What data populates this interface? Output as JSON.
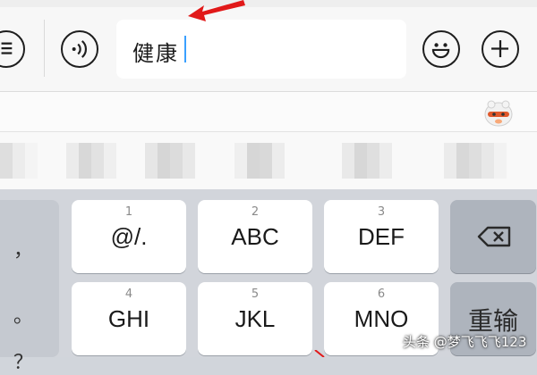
{
  "input_bar": {
    "text_value": "健康",
    "arrow_color": "#e11919",
    "icons": [
      "menu-icon",
      "voice-icon",
      "emoji-icon",
      "plus-icon"
    ]
  },
  "candidate_bar": {
    "mascot_icon": "input-method-mascot-icon"
  },
  "keyboard": {
    "side_keys": [
      "，",
      "。",
      "？"
    ],
    "keys": [
      {
        "num": "1",
        "label": "@/."
      },
      {
        "num": "2",
        "label": "ABC"
      },
      {
        "num": "3",
        "label": "DEF"
      },
      {
        "num": "4",
        "label": "GHI"
      },
      {
        "num": "5",
        "label": "JKL"
      },
      {
        "num": "6",
        "label": "MNO"
      }
    ],
    "backspace_icon": "backspace-icon",
    "reenter_label": "重输"
  },
  "watermark": "头条 @梦飞飞飞123"
}
